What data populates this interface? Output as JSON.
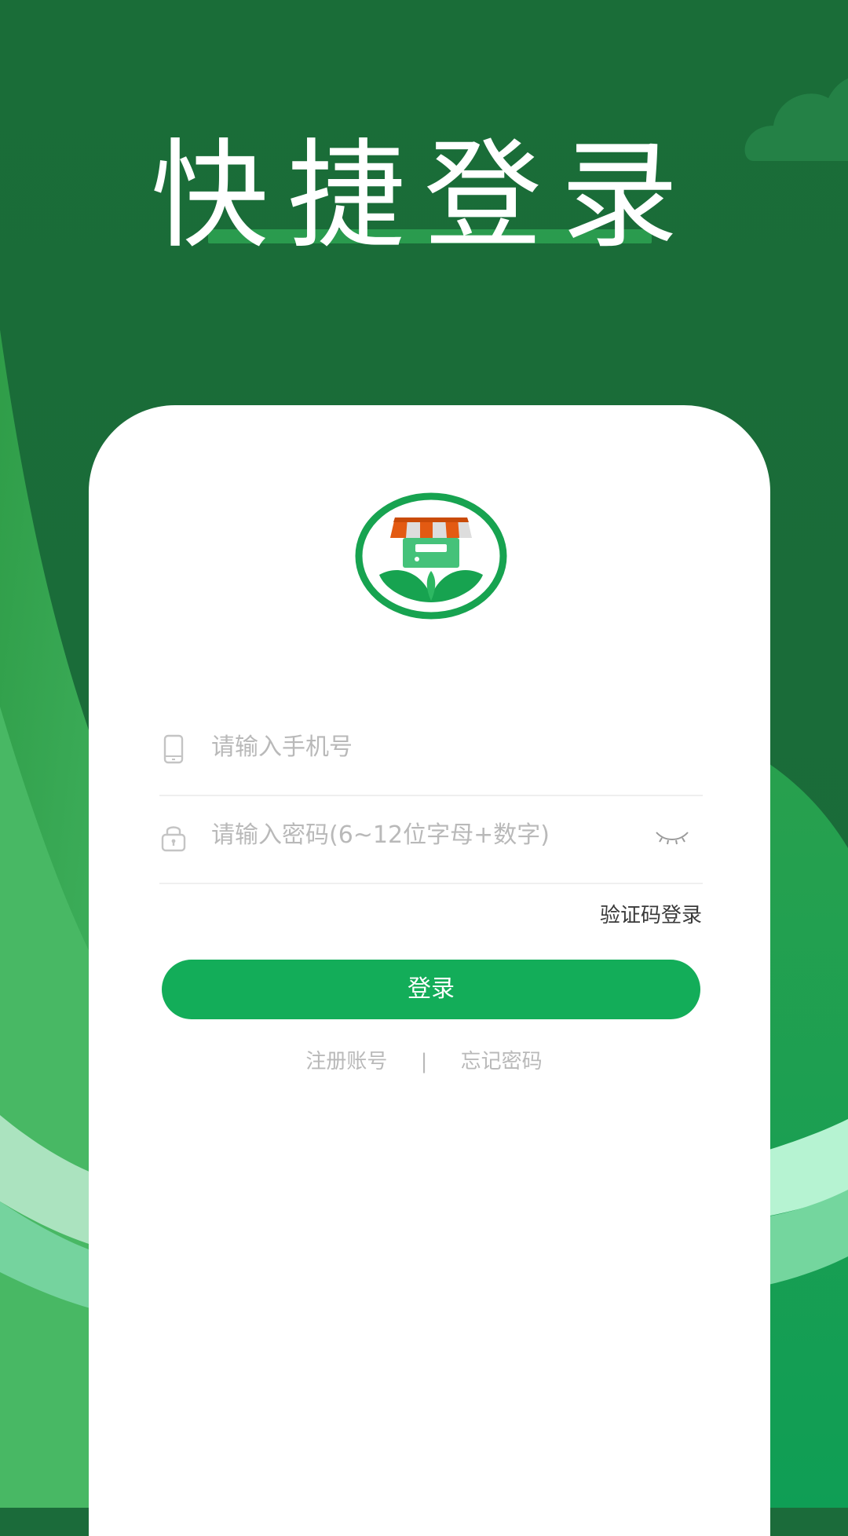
{
  "header": {
    "title": "快捷登录"
  },
  "form": {
    "phone_placeholder": "请输入手机号",
    "password_placeholder": "请输入密码(6~12位字母+数字)",
    "sms_login_label": "验证码登录",
    "login_button_label": "登录"
  },
  "footer_links": {
    "register_label": "注册账号",
    "separator": "|",
    "forgot_password_label": "忘记密码"
  },
  "icons": {
    "phone": "phone-icon",
    "lock": "lock-icon",
    "eye": "eye-closed-icon",
    "logo": "store-leaf-logo"
  },
  "colors": {
    "brand_green": "#13ad59",
    "background_dark": "#1b6b3a",
    "placeholder_gray": "#b9b9b9"
  }
}
